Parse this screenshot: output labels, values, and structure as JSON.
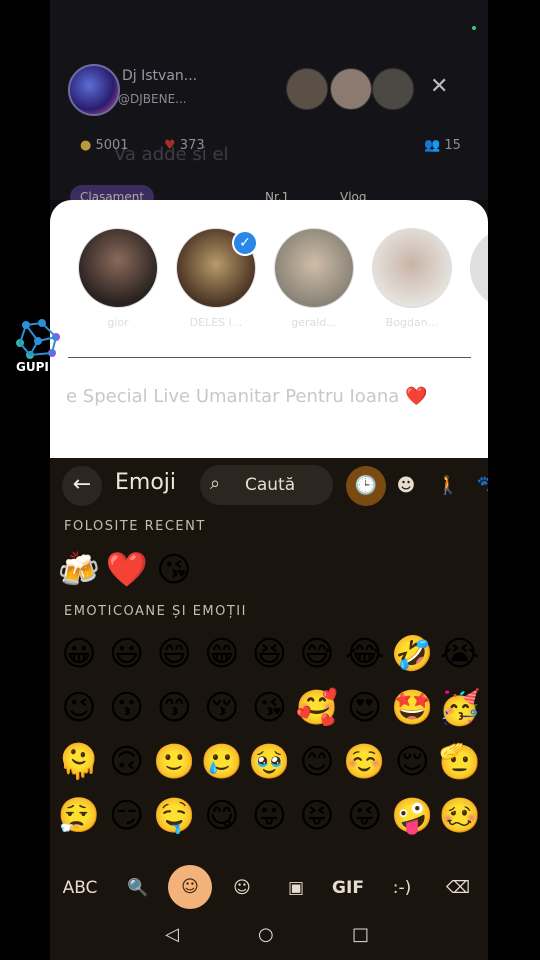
{
  "live": {
    "host_name": "Dj Istvan...",
    "host_handle": "@DJBENE...",
    "coins": "5001",
    "hearts": "373",
    "viewers": "15",
    "ghost_text": "Va adde si el",
    "chips": [
      "Clasament",
      "Nr.1",
      "Vlog"
    ]
  },
  "sheet": {
    "friends": [
      {
        "name": "gior"
      },
      {
        "name": "DELES I..."
      },
      {
        "name": "gerald..."
      },
      {
        "name": "Bogdan..."
      }
    ],
    "message": "e Special Live Umanitar Pentru Ioana",
    "message_emoji": "❤️"
  },
  "keyboard": {
    "title": "Emoji",
    "search_placeholder": "Caută",
    "back_icon": "arrow-left-icon",
    "recent_label": "FOLOSITE RECENT",
    "recent": [
      "🍻",
      "❤️",
      "😘"
    ],
    "emotions_label": "EMOTICOANE ȘI EMOȚII",
    "rows": [
      [
        "😀",
        "😃",
        "😄",
        "😁",
        "😆",
        "😅",
        "😂",
        "🤣",
        "😭"
      ],
      [
        "😉",
        "😗",
        "😙",
        "😚",
        "😘",
        "🥰",
        "😍",
        "🤩",
        "🥳"
      ],
      [
        "🫠",
        "🙃",
        "🙂",
        "🥲",
        "🥹",
        "😊",
        "☺️",
        "😌",
        "🫡"
      ],
      [
        "😮‍💨",
        "😏",
        "🤤",
        "😋",
        "😛",
        "😝",
        "😜",
        "🤪",
        "🥴"
      ]
    ],
    "bottom": {
      "abc": "ABC",
      "gif": "GIF",
      "emoticon": ":-)"
    }
  },
  "watermark": "GUPI",
  "colors": {
    "accent": "#f2b27a",
    "active_category": "#7a4a12",
    "check": "#2a86e8",
    "keyboard_bg": "#1a140e"
  }
}
